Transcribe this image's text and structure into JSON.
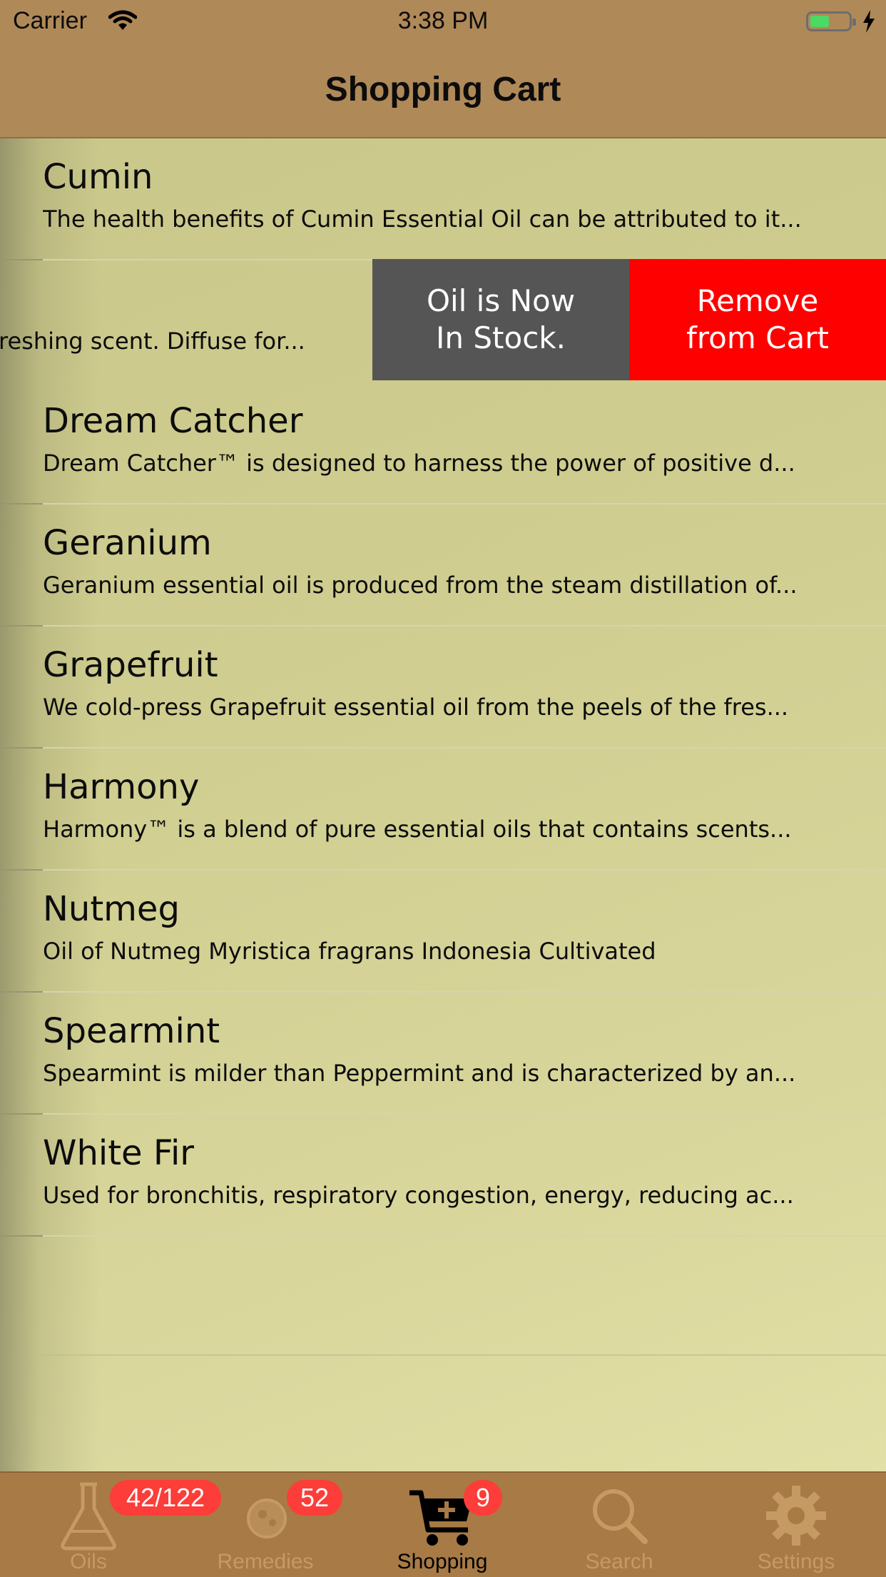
{
  "status_bar": {
    "carrier": "Carrier",
    "time": "3:38 PM"
  },
  "nav": {
    "title": "Shopping Cart"
  },
  "cart_items": [
    {
      "name": "Cumin",
      "description": "The health benefits of Cumin Essential Oil can be attributed to it..."
    },
    {
      "name": "Dream Catcher",
      "description": "Dream Catcher™ is designed to harness the power of positive d..."
    },
    {
      "name": "Geranium",
      "description": "Geranium essential oil is produced from the steam distillation of..."
    },
    {
      "name": "Grapefruit",
      "description": "We cold-press Grapefruit essential oil from the peels of the fres..."
    },
    {
      "name": "Harmony",
      "description": "Harmony™ is a blend of pure essential oils that contains scents..."
    },
    {
      "name": "Nutmeg",
      "description": "Oil of Nutmeg Myristica fragrans Indonesia Cultivated"
    },
    {
      "name": "Spearmint",
      "description": "Spearmint is milder than Peppermint and is characterized by an..."
    },
    {
      "name": "White Fir",
      "description": "Used for bronchitis, respiratory congestion, energy, reducing ac..."
    }
  ],
  "swiped_row": {
    "description_fragment": "reshing scent. Diffuse for...",
    "stock_action": "Oil is Now\nIn Stock.",
    "remove_action": "Remove\nfrom Cart",
    "stock_color": "#555555",
    "remove_color": "#fe0000"
  },
  "tabs": [
    {
      "label": "Oils",
      "icon": "flask-icon",
      "badge": "42/122",
      "active": false
    },
    {
      "label": "Remedies",
      "icon": "remedies-icon",
      "badge": "52",
      "active": false
    },
    {
      "label": "Shopping",
      "icon": "cart-icon",
      "badge": "9",
      "active": true
    },
    {
      "label": "Search",
      "icon": "search-icon",
      "badge": "",
      "active": false
    },
    {
      "label": "Settings",
      "icon": "gear-icon",
      "badge": "",
      "active": false
    }
  ],
  "colors": {
    "nav_bar": "#b08958",
    "tab_bar": "#a87a45",
    "badge": "#fc3d39",
    "inactive_tab": "#c59a63"
  }
}
